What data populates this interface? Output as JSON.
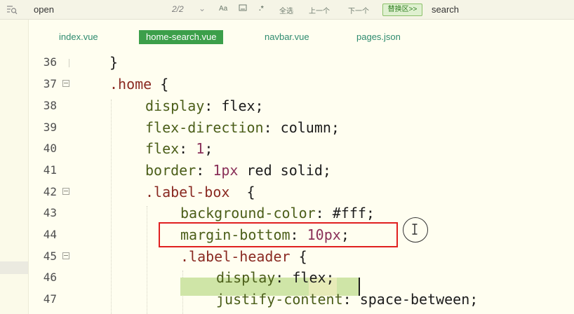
{
  "findbar": {
    "query": "open",
    "match_count": "2/2",
    "chevron": "⌄",
    "opt_case": "Aa",
    "opt_word": "\u0001\b\u0001",
    "opt_regex": ".*",
    "select_all": "全选",
    "prev": "上一个",
    "next": "下一个",
    "replace_toggle": "替换区>>",
    "replace_query": "search"
  },
  "tabs": [
    {
      "label": "index.vue"
    },
    {
      "label": "home-search.vue"
    },
    {
      "label": "navbar.vue"
    },
    {
      "label": "pages.json"
    }
  ],
  "lines": [
    {
      "num": "36"
    },
    {
      "num": "37"
    },
    {
      "num": "38"
    },
    {
      "num": "39"
    },
    {
      "num": "40"
    },
    {
      "num": "41"
    },
    {
      "num": "42"
    },
    {
      "num": "43"
    },
    {
      "num": "44"
    },
    {
      "num": "45"
    },
    {
      "num": "46"
    },
    {
      "num": "47"
    }
  ],
  "code": {
    "l36": "}",
    "l37_sel": ".home",
    "l37_brace": " {",
    "l38_prop": "display",
    "l38_val": ": flex;",
    "l39_prop": "flex-direction",
    "l39_val": ": column;",
    "l40_prop": "flex",
    "l40_colon": ": ",
    "l40_num": "1",
    "l40_end": ";",
    "l41_prop": "border",
    "l41_colon": ": ",
    "l41_num": "1px",
    "l41_val": " red solid;",
    "l42_sel": ".label-box",
    "l42_brace": "  {",
    "l43_prop": "background-color",
    "l43_val": ": #fff;",
    "l44_prop": "margin-bottom",
    "l44_colon": ": ",
    "l44_num": "10px",
    "l44_end": ";",
    "l45_sel": ".label-header",
    "l45_brace": " {",
    "l46_prop": "display",
    "l46_val": ": flex;",
    "l47_prop": "justify-content",
    "l47_val": ": space-between;"
  },
  "colors": {
    "active_tab": "#3c9f4a",
    "highlight_box": "#e02020",
    "selection": "#cfe5a7"
  }
}
